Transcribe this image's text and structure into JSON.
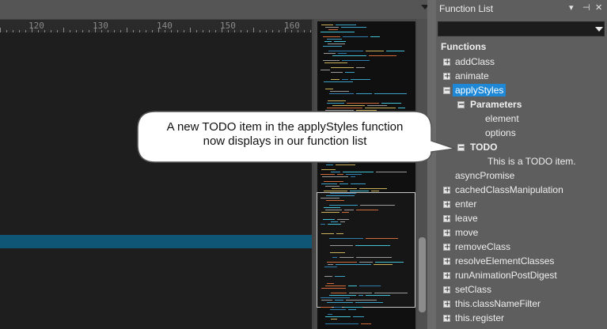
{
  "editor": {
    "ruler_labels": [
      "120",
      "130",
      "140",
      "150",
      "160"
    ]
  },
  "function_list": {
    "title": "Function List",
    "controls": {
      "dropdown": "▾",
      "pin": "⊣",
      "close": "✕"
    },
    "section_label": "Functions",
    "items": [
      {
        "label": "addClass"
      },
      {
        "label": "animate"
      },
      {
        "label": "applyStyles"
      },
      {
        "label": "Parameters"
      },
      {
        "label": "element"
      },
      {
        "label": "options"
      },
      {
        "label": "TODO"
      },
      {
        "label": "This is a TODO item."
      },
      {
        "label": "asyncPromise"
      },
      {
        "label": "cachedClassManipulation"
      },
      {
        "label": "enter"
      },
      {
        "label": "leave"
      },
      {
        "label": "move"
      },
      {
        "label": "removeClass"
      },
      {
        "label": "resolveElementClasses"
      },
      {
        "label": "runAnimationPostDigest"
      },
      {
        "label": "setClass"
      },
      {
        "label": "this.classNameFilter"
      },
      {
        "label": "this.register"
      }
    ]
  },
  "callout": {
    "line1": "A new TODO item in the applyStyles function",
    "line2": "now displays in our function list"
  },
  "colors": {
    "selection": "#1e87d6",
    "current_line": "#0e5576",
    "editor_background": "#1e1e1e"
  }
}
